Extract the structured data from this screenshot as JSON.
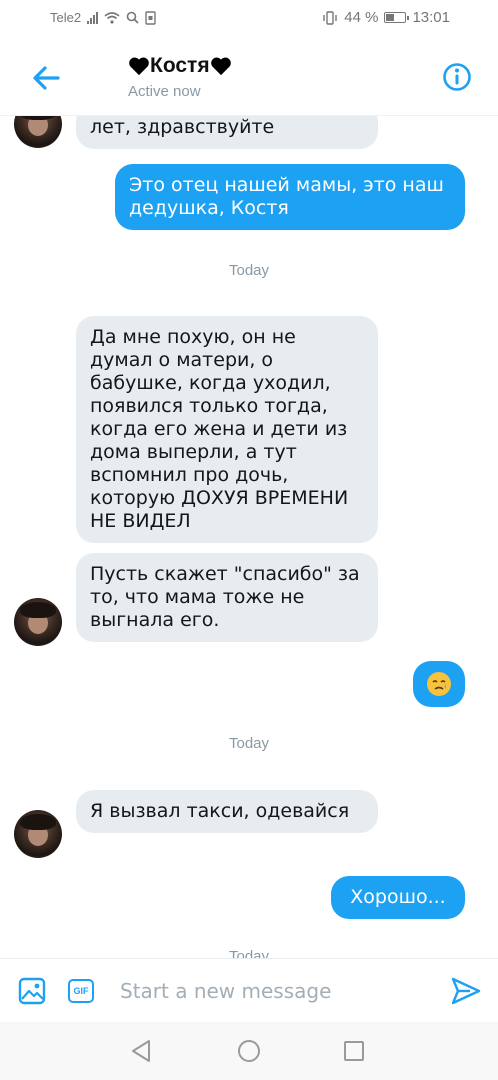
{
  "status_bar": {
    "carrier": "Tele2",
    "battery_text": "44 %",
    "battery_level": 0.44,
    "time": "13:01"
  },
  "header": {
    "title": "Костя",
    "subtitle": "Active now"
  },
  "messages": [
    {
      "from": "them",
      "text": "лет, здравствуйте"
    },
    {
      "from": "me",
      "text": "Это отец нашей мамы, это наш дедушка, Костя"
    },
    {
      "type": "time",
      "text": "Today"
    },
    {
      "from": "them",
      "text": "Да мне похую, он не думал о матери, о бабушке, когда уходил, появился только тогда, когда его жена и дети из дома выперли, а тут вспомнил про дочь, которую ДОХУЯ ВРЕМЕНИ НЕ ВИДЕЛ"
    },
    {
      "from": "them",
      "text": "Пусть скажет \"спасибо\" за то, что мама тоже не выгнала его."
    },
    {
      "from": "me",
      "text": "🥲"
    },
    {
      "type": "time",
      "text": "Today"
    },
    {
      "from": "them",
      "text": "Я вызвал такси, одевайся"
    },
    {
      "from": "me",
      "text": "Хорошо..."
    },
    {
      "type": "time",
      "text": "Today"
    }
  ],
  "compose": {
    "placeholder": "Start a new message"
  },
  "icons": {
    "back": "arrow-left-icon",
    "info": "info-icon",
    "image": "image-icon",
    "gif": "GIF",
    "send": "send-icon"
  },
  "colors": {
    "accent": "#1da1f2",
    "received_bubble": "#e6ecf0",
    "muted": "#8899a6"
  }
}
